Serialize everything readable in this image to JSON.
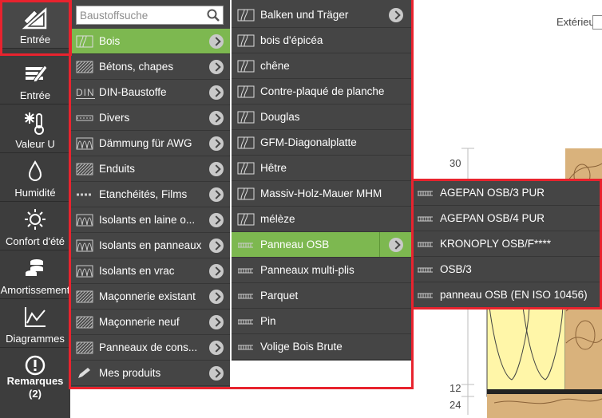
{
  "nav": [
    {
      "label": "Entrée",
      "icon": "pencil-ruler-icon"
    },
    {
      "label": "Entrée",
      "icon": "layers-edit-icon"
    },
    {
      "label": "Valeur U",
      "icon": "snowflake-thermometer-icon"
    },
    {
      "label": "Humidité",
      "icon": "water-drop-icon"
    },
    {
      "label": "Confort d'été",
      "icon": "sun-icon"
    },
    {
      "label": "Amortissement",
      "icon": "coins-icon"
    },
    {
      "label": "Diagrammes",
      "icon": "line-chart-icon"
    },
    {
      "label": "Remarques",
      "count": "(2)",
      "icon": "alert-circle-icon"
    }
  ],
  "search": {
    "placeholder": "Baustoffsuche",
    "icon": "search-icon"
  },
  "categories": [
    {
      "label": "Bois",
      "icon": "wood-grain-icon",
      "selected": true
    },
    {
      "label": "Bétons, chapes",
      "icon": "concrete-hatch-icon"
    },
    {
      "label": "DIN-Baustoffe",
      "icon": "din-icon",
      "icon_text": "DIN"
    },
    {
      "label": "Divers",
      "icon": "misc-material-icon"
    },
    {
      "label": "Dämmung für AWG",
      "icon": "insulation-icon"
    },
    {
      "label": "Enduits",
      "icon": "plaster-hatch-icon"
    },
    {
      "label": "Etanchéités, Films",
      "icon": "membrane-icon"
    },
    {
      "label": "Isolants en laine o...",
      "icon": "insulation-icon"
    },
    {
      "label": "Isolants en panneaux",
      "icon": "insulation-icon"
    },
    {
      "label": "Isolants en vrac",
      "icon": "insulation-icon"
    },
    {
      "label": "Maçonnerie existant",
      "icon": "masonry-hatch-icon"
    },
    {
      "label": "Maçonnerie neuf",
      "icon": "masonry-hatch-icon"
    },
    {
      "label": "Panneaux de cons...",
      "icon": "panel-hatch-icon"
    },
    {
      "label": "Mes produits",
      "icon": "pencil-icon"
    }
  ],
  "wood_items": [
    {
      "label": "Balken und Träger",
      "has_sub": true
    },
    {
      "label": "bois d'épicéa"
    },
    {
      "label": "chêne"
    },
    {
      "label": "Contre-plaqué de planche"
    },
    {
      "label": "Douglas"
    },
    {
      "label": "GFM-Diagonalplatte"
    },
    {
      "label": "Hêtre"
    },
    {
      "label": "Massiv-Holz-Mauer MHM"
    },
    {
      "label": "mélèze"
    },
    {
      "label": "Panneau OSB",
      "has_sub": true,
      "selected": true,
      "icon": "osb-icon"
    },
    {
      "label": "Panneaux multi-plis",
      "icon": "osb-icon"
    },
    {
      "label": "Parquet",
      "icon": "osb-icon"
    },
    {
      "label": "Pin",
      "icon": "osb-icon"
    },
    {
      "label": "Volige Bois Brute",
      "icon": "osb-icon"
    }
  ],
  "osb_items": [
    {
      "label": "AGEPAN OSB/3 PUR"
    },
    {
      "label": "AGEPAN OSB/4 PUR"
    },
    {
      "label": "KRONOPLY OSB/F****"
    },
    {
      "label": "OSB/3"
    },
    {
      "label": "panneau OSB (EN ISO 10456)"
    }
  ],
  "drawing": {
    "exterior_label": "Extérieu",
    "dims": [
      "30",
      "12",
      "24"
    ]
  },
  "colors": {
    "accent": "#7db850",
    "highlight": "#e8232e",
    "panel": "#454545",
    "nav": "#3d3d3d"
  }
}
